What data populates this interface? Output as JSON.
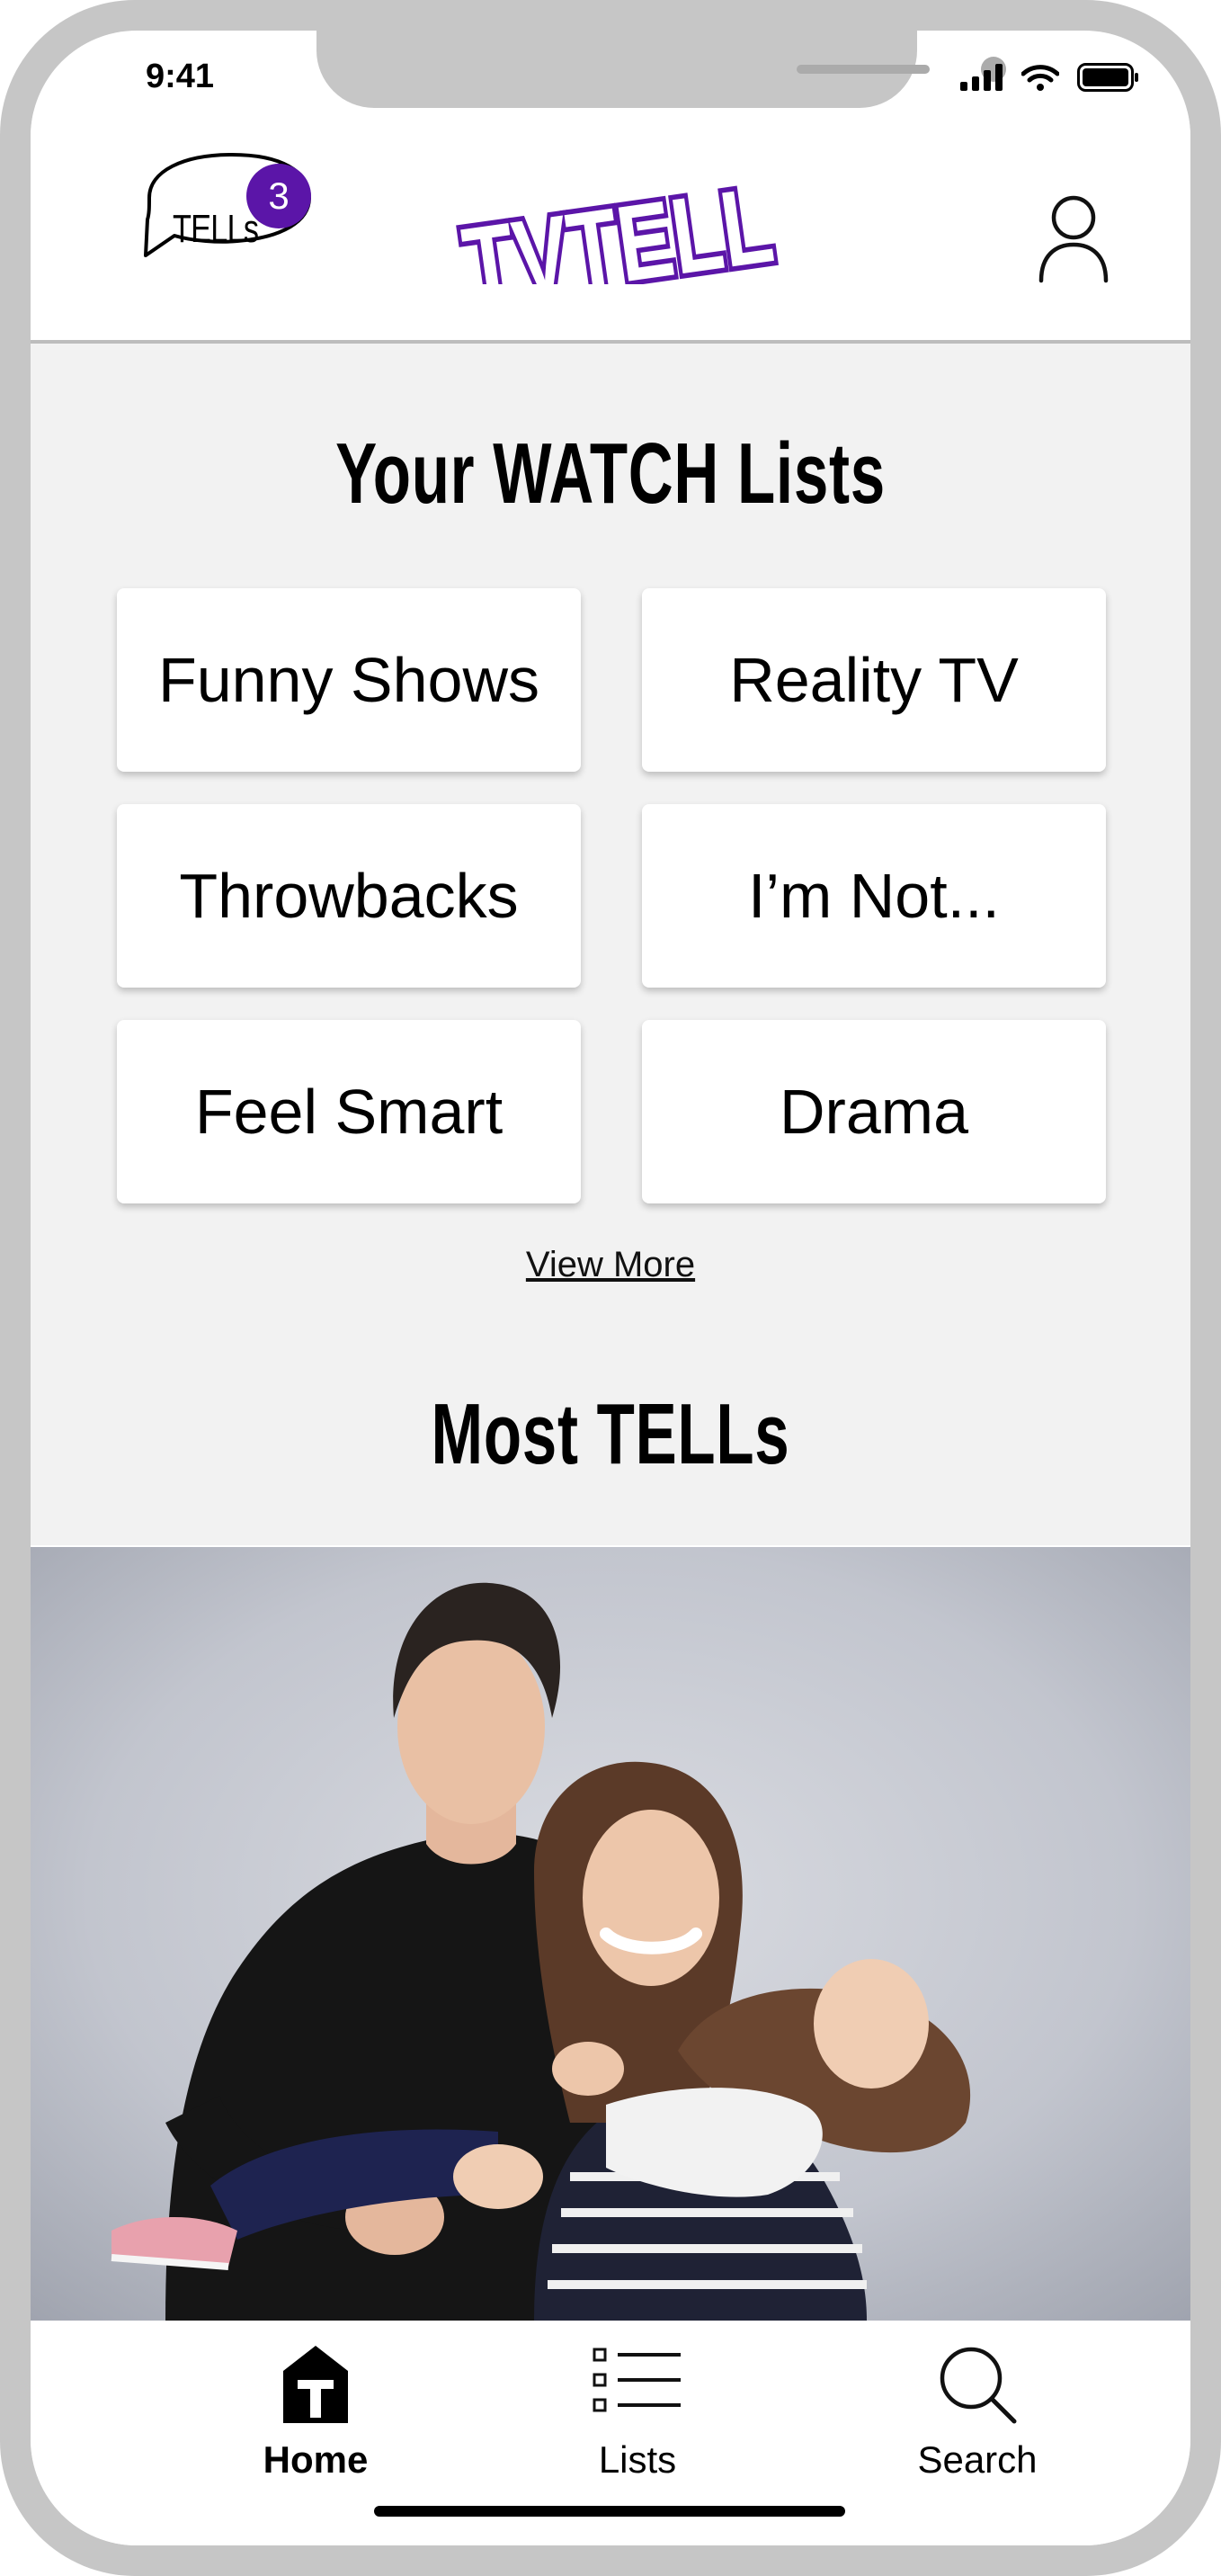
{
  "status_bar": {
    "time": "9:41"
  },
  "header": {
    "tells_label": "TELLs",
    "tells_count": "3",
    "logo_text": "TVTELL",
    "brand_color": "#5b15a8"
  },
  "watch_lists": {
    "title": "Your WATCH Lists",
    "items": [
      {
        "label": "Funny Shows"
      },
      {
        "label": "Reality TV"
      },
      {
        "label": "Throwbacks"
      },
      {
        "label": "I’m Not..."
      },
      {
        "label": "Feel Smart"
      },
      {
        "label": "Drama"
      }
    ],
    "view_more": "View More"
  },
  "most_tells": {
    "title": "Most TELLs"
  },
  "tabbar": {
    "tabs": [
      {
        "label": "Home",
        "icon": "home-t-icon",
        "active": true
      },
      {
        "label": "Lists",
        "icon": "list-icon",
        "active": false
      },
      {
        "label": "Search",
        "icon": "search-icon",
        "active": false
      }
    ]
  }
}
